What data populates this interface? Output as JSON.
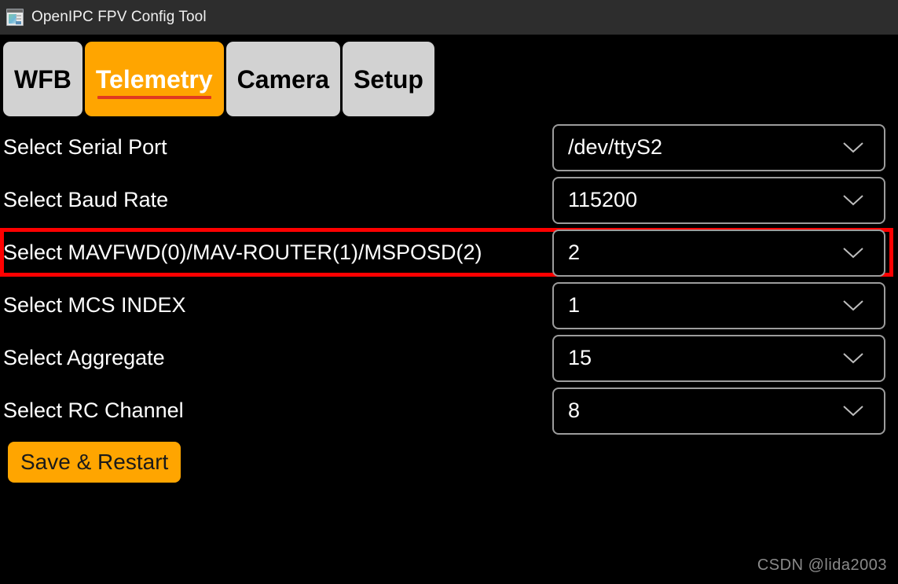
{
  "window": {
    "title": "OpenIPC FPV Config Tool",
    "icon": "app-window-icon",
    "titlebar_bg": "#2d2d2d",
    "background": "#000000"
  },
  "colors": {
    "accent_orange": "#ffa500",
    "active_tab_underline": "#e03a20",
    "highlight_red": "#ff0000",
    "tab_inactive_bg": "#d2d2d2",
    "select_border": "#9c9c9c",
    "text_primary": "#ffffff",
    "watermark": "#8a8a8a"
  },
  "tabs": [
    {
      "label": "WFB",
      "active": false
    },
    {
      "label": "Telemetry",
      "active": true
    },
    {
      "label": "Camera",
      "active": false
    },
    {
      "label": "Setup",
      "active": false
    }
  ],
  "form": {
    "rows": [
      {
        "label": "Select Serial Port",
        "value": "/dev/ttyS2",
        "icon": "chevron-down-icon",
        "highlighted": false
      },
      {
        "label": "Select Baud Rate",
        "value": "115200",
        "icon": "chevron-down-icon",
        "highlighted": false
      },
      {
        "label": "Select MAVFWD(0)/MAV-ROUTER(1)/MSPOSD(2)",
        "value": "2",
        "icon": "chevron-down-icon",
        "highlighted": true
      },
      {
        "label": "Select MCS INDEX",
        "value": "1",
        "icon": "chevron-down-icon",
        "highlighted": false
      },
      {
        "label": "Select Aggregate",
        "value": "15",
        "icon": "chevron-down-icon",
        "highlighted": false
      },
      {
        "label": "Select RC Channel",
        "value": "8",
        "icon": "chevron-down-icon",
        "highlighted": false
      }
    ]
  },
  "actions": {
    "save_label": "Save & Restart"
  },
  "watermark": {
    "text": "CSDN @lida2003"
  }
}
